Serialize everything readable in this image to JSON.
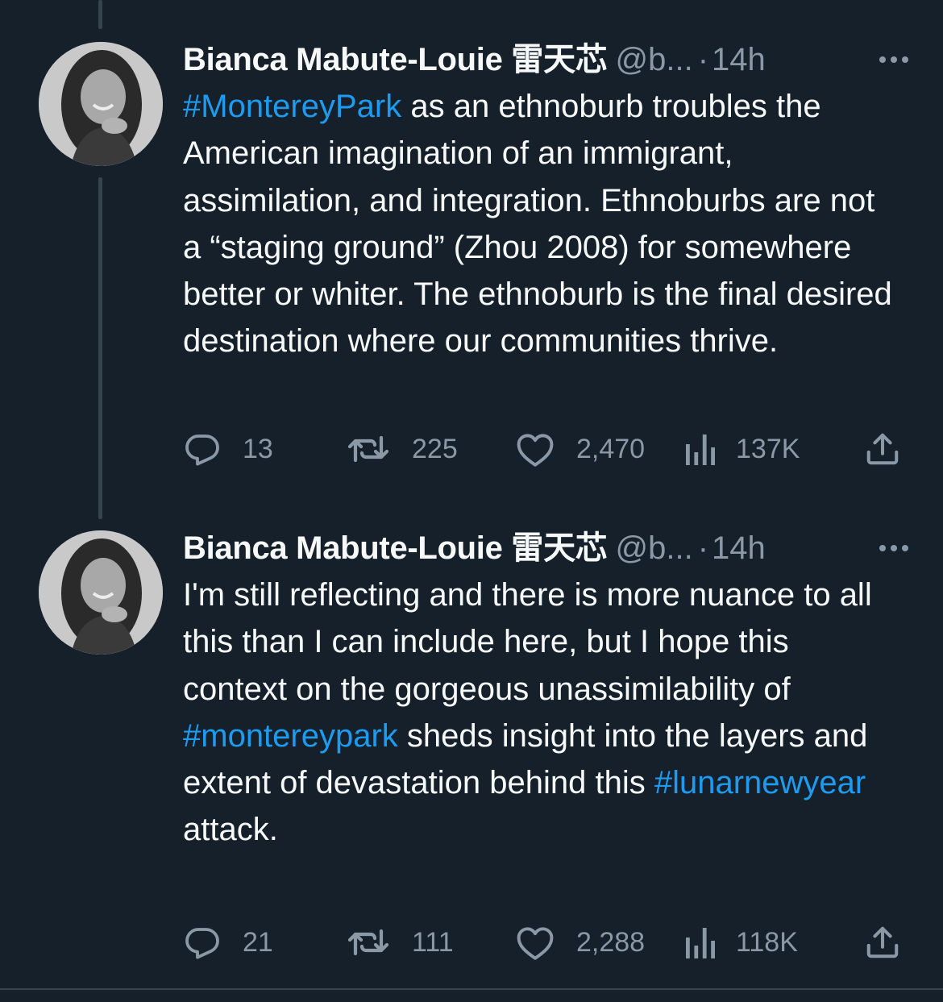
{
  "tweets": [
    {
      "author_name": "Bianca Mabute-Louie 雷天芯",
      "handle": "@b...",
      "separator": "·",
      "time": "14h",
      "body": [
        {
          "type": "hashtag",
          "text": "#MontereyPark"
        },
        {
          "type": "text",
          "text": " as an ethnoburb troubles the American imagination of an immigrant, assimilation, and integration. Ethnoburbs are not a “staging ground” (Zhou 2008) for somewhere better or whiter. The ethnoburb is the final desired destination where our communities thrive."
        }
      ],
      "replies": "13",
      "retweets": "225",
      "likes": "2,470",
      "views": "137K"
    },
    {
      "author_name": "Bianca Mabute-Louie 雷天芯",
      "handle": "@b...",
      "separator": "·",
      "time": "14h",
      "body": [
        {
          "type": "text",
          "text": "I'm still reflecting and there is more nuance to all this than I can include here, but I hope this context on the gorgeous unassimilability of "
        },
        {
          "type": "hashtag",
          "text": "#montereypark"
        },
        {
          "type": "text",
          "text": " sheds insight into the layers and extent of devastation behind this "
        },
        {
          "type": "hashtag",
          "text": "#lunarnewyear"
        },
        {
          "type": "text",
          "text": " attack."
        }
      ],
      "replies": "21",
      "retweets": "111",
      "likes": "2,288",
      "views": "118K"
    }
  ],
  "icons": {
    "reply": "speech-bubble-icon",
    "retweet": "retweet-arrows-icon",
    "like": "heart-outline-icon",
    "views": "bar-chart-icon",
    "share": "share-upload-icon",
    "more": "three-dots-icon"
  },
  "colors": {
    "background": "#15202b",
    "text": "#f7f9f9",
    "muted": "#8b98a5",
    "hashtag": "#1d9bf0",
    "thread_line": "#38444d"
  }
}
